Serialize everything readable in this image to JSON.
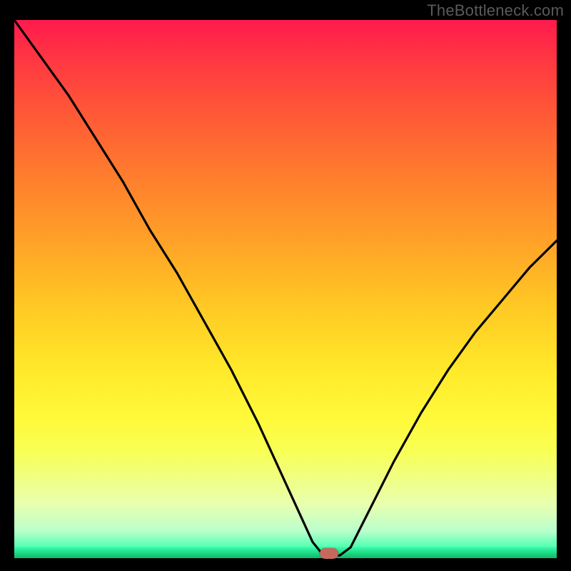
{
  "watermark": "TheBottleneck.com",
  "chart_data": {
    "type": "line",
    "title": "",
    "xlabel": "",
    "ylabel": "",
    "xlim": [
      0,
      100
    ],
    "ylim": [
      0,
      100
    ],
    "series": [
      {
        "name": "bottleneck-curve",
        "x": [
          0,
          5,
          10,
          15,
          20,
          25,
          30,
          35,
          40,
          45,
          50,
          55,
          57,
          60,
          62,
          65,
          70,
          75,
          80,
          85,
          90,
          95,
          100
        ],
        "y": [
          100,
          93,
          86,
          78,
          70,
          61,
          53,
          44,
          35,
          25,
          14,
          3,
          0.5,
          0.5,
          2,
          8,
          18,
          27,
          35,
          42,
          48,
          54,
          59
        ]
      }
    ],
    "marker": {
      "x": 58,
      "y": 0.8
    },
    "gradient_stops": [
      {
        "pos": 0,
        "color": "#ff1a4d"
      },
      {
        "pos": 16,
        "color": "#ff5438"
      },
      {
        "pos": 40,
        "color": "#ff9e28"
      },
      {
        "pos": 65,
        "color": "#ffe92a"
      },
      {
        "pos": 90,
        "color": "#e8ffb0"
      },
      {
        "pos": 100,
        "color": "#18e28a"
      }
    ]
  }
}
